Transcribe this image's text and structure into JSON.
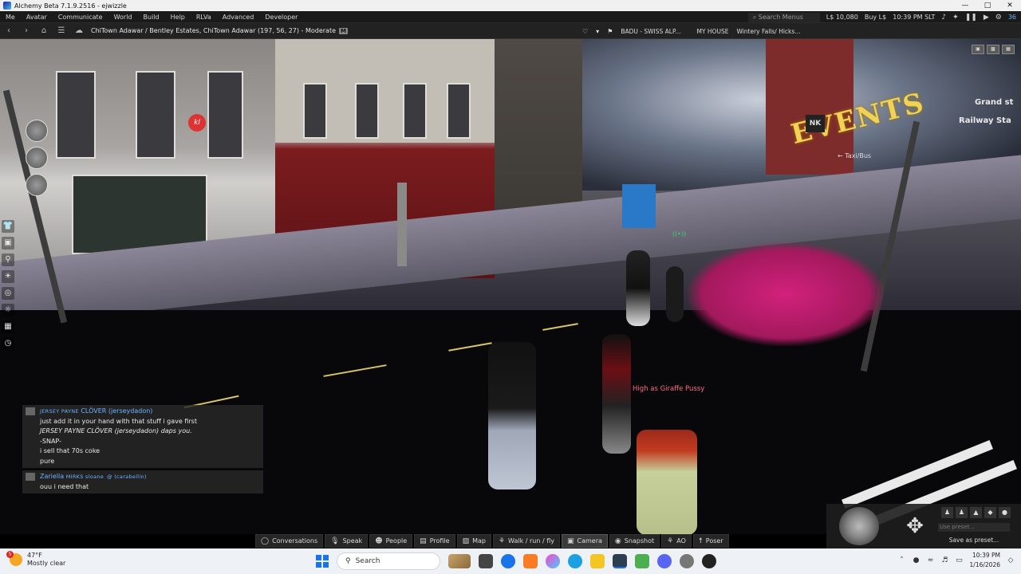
{
  "window": {
    "title": "Alchemy Beta 7.1.9.2516 - ejwizzle",
    "controls": [
      "minimize",
      "maximize",
      "close"
    ]
  },
  "menu": {
    "items": [
      "Me",
      "Avatar",
      "Communicate",
      "World",
      "Build",
      "Help",
      "RLVa",
      "Advanced",
      "Developer"
    ],
    "search_placeholder": "Search Menus",
    "balance": "L$ 10,080",
    "buy": "Buy L$",
    "time": "10:39 PM SLT",
    "fps": "36"
  },
  "nav": {
    "location": "ChiTown Adawar / Bentley Estates, ChiTown Adawar (197, 56, 27) - Moderate",
    "maturity_badge": "M",
    "favorites": [
      "BADU - SWISS ALP...",
      "MY HOUSE",
      "Wintery Falls/ Hicks..."
    ]
  },
  "scene": {
    "badge_text": "kl",
    "floating_text": "High as Giraffe Pussy",
    "sign_text": "EVENTS",
    "station_lines": [
      "Grand st",
      "Railway Sta"
    ],
    "taxi_label": "← Taxi/Bus",
    "nk_label": "NK",
    "voice_indicator": "((•))"
  },
  "chat": {
    "messages": [
      {
        "name_prefix": "JERSEY PAYNE",
        "name_rest": "CLÖVER (jerseydadon)",
        "lines": [
          "just add it in your hand with that stuff i gave first",
          "JERSEY PAYNE CLÖVER (jerseydadon) daps you.",
          "-SNAP-",
          "i sell that 70s coke",
          "pure"
        ]
      },
      {
        "name_prefix": "Zariella",
        "name_rest": "MIRKS sloane  @ (carabellin)",
        "lines": [
          "ouu i need that"
        ]
      }
    ]
  },
  "toolbar": {
    "buttons": [
      {
        "label": "Conversations",
        "icon": "chat-bubble-icon"
      },
      {
        "label": "Speak",
        "icon": "microphone-icon"
      },
      {
        "label": "People",
        "icon": "people-icon"
      },
      {
        "label": "Profile",
        "icon": "profile-card-icon"
      },
      {
        "label": "Map",
        "icon": "map-icon"
      },
      {
        "label": "Walk / run / fly",
        "icon": "walk-icon"
      },
      {
        "label": "Camera",
        "icon": "camera-icon"
      },
      {
        "label": "Snapshot",
        "icon": "snapshot-icon"
      },
      {
        "label": "AO",
        "icon": "ao-icon"
      },
      {
        "label": "Poser",
        "icon": "poser-icon"
      }
    ],
    "active": "Camera"
  },
  "camera_controls": {
    "preset_placeholder": "Use preset...",
    "save_preset": "Save as preset..."
  },
  "taskbar": {
    "weather_temp": "47°F",
    "weather_desc": "Mostly clear",
    "weather_badge": "5",
    "search": "Search",
    "clock_time": "10:39 PM",
    "clock_date": "1/16/2026"
  },
  "colors": {
    "chat_name": "#6fb3ff",
    "floating_text": "#ff6a8a",
    "sign": "#f0d256",
    "car": "#d2217c"
  }
}
